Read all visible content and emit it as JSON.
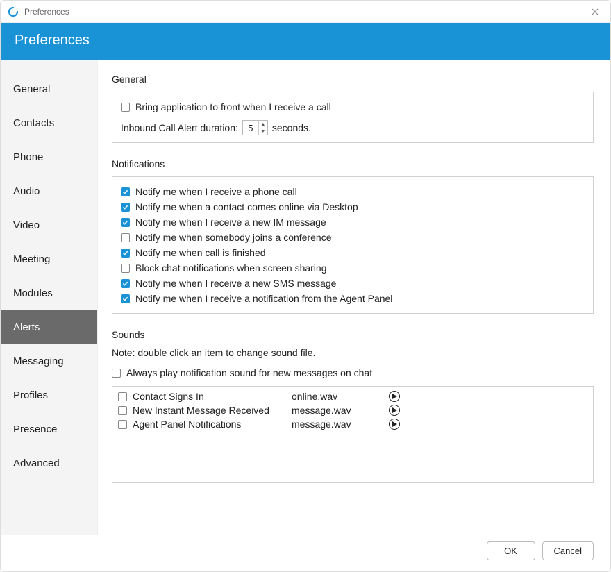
{
  "window": {
    "title": "Preferences"
  },
  "header": {
    "title": "Preferences"
  },
  "sidebar": {
    "items": [
      {
        "label": "General"
      },
      {
        "label": "Contacts"
      },
      {
        "label": "Phone"
      },
      {
        "label": "Audio"
      },
      {
        "label": "Video"
      },
      {
        "label": "Meeting"
      },
      {
        "label": "Modules"
      },
      {
        "label": "Alerts"
      },
      {
        "label": "Messaging"
      },
      {
        "label": "Profiles"
      },
      {
        "label": "Presence"
      },
      {
        "label": "Advanced"
      }
    ],
    "active_index": 7
  },
  "sections": {
    "general": {
      "title": "General",
      "bring_to_front": {
        "label": "Bring application to front when I receive a call",
        "checked": false
      },
      "duration": {
        "prefix": "Inbound Call Alert duration:",
        "value": "5",
        "suffix": "seconds."
      }
    },
    "notifications": {
      "title": "Notifications",
      "items": [
        {
          "label": "Notify me when I receive a phone call",
          "checked": true
        },
        {
          "label": "Notify me when a contact comes online via Desktop",
          "checked": true
        },
        {
          "label": "Notify me when I receive a new IM message",
          "checked": true
        },
        {
          "label": "Notify me when somebody joins a conference",
          "checked": false
        },
        {
          "label": "Notify me when call is finished",
          "checked": true
        },
        {
          "label": "Block chat notifications when screen sharing",
          "checked": false
        },
        {
          "label": "Notify me when I receive a new SMS message",
          "checked": true
        },
        {
          "label": "Notify me when I receive a notification from the Agent Panel",
          "checked": true
        }
      ]
    },
    "sounds": {
      "title": "Sounds",
      "note": "Note: double click an item to change sound file.",
      "always_play": {
        "label": "Always play notification sound for new messages on chat",
        "checked": false
      },
      "items": [
        {
          "name": "Contact Signs In",
          "file": "online.wav",
          "checked": false
        },
        {
          "name": "New Instant Message Received",
          "file": "message.wav",
          "checked": false
        },
        {
          "name": "Agent Panel Notifications",
          "file": "message.wav",
          "checked": false
        }
      ]
    }
  },
  "footer": {
    "ok": "OK",
    "cancel": "Cancel"
  }
}
